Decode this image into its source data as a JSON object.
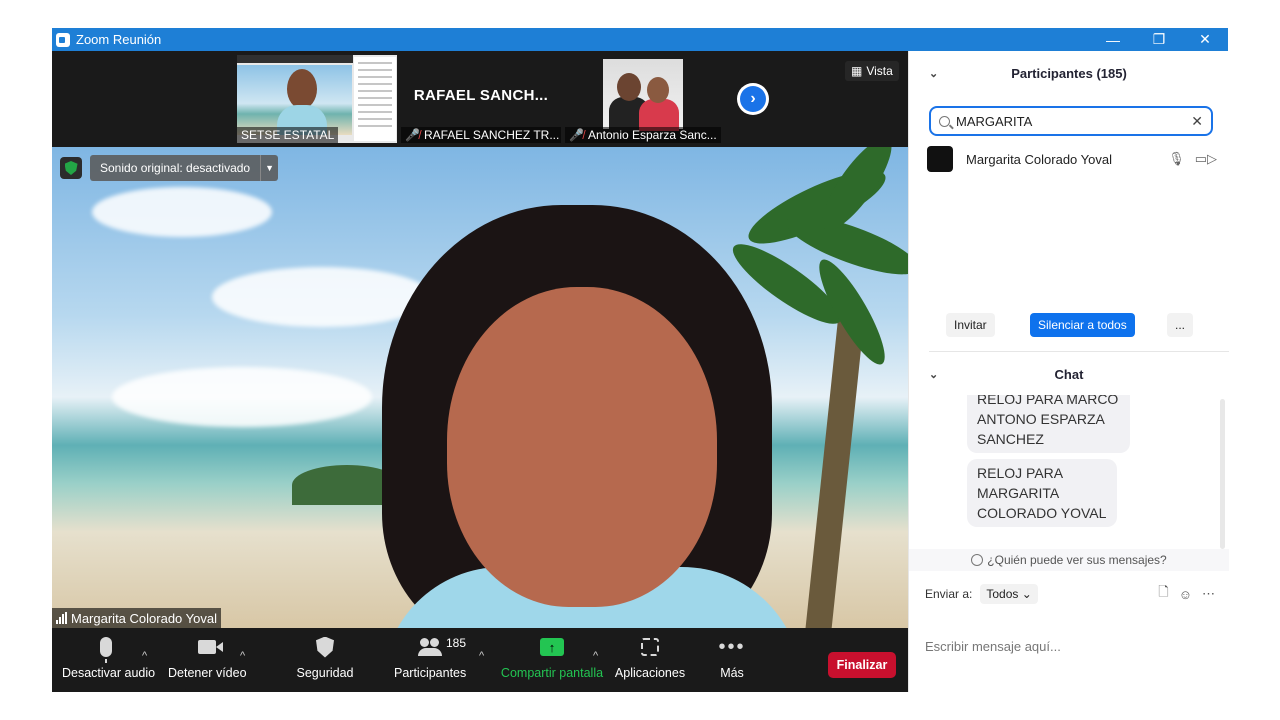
{
  "window": {
    "title": "Zoom Reunión",
    "minimize": "—",
    "restore": "❐",
    "close": "✕"
  },
  "thumbnails": [
    {
      "name": "SETSE ESTATAL",
      "muted": false
    },
    {
      "name": "RAFAEL SANCHEZ TR...",
      "big_name": "RAFAEL  SANCH...",
      "muted": true
    },
    {
      "name": "Antonio Esparza Sanc...",
      "muted": true
    }
  ],
  "view_button": "Vista",
  "audio_badge": {
    "label": "Sonido original: desactivado"
  },
  "speaker": {
    "name": "Margarita Colorado Yoval"
  },
  "toolbar": {
    "mute": "Desactivar audio",
    "video": "Detener vídeo",
    "security": "Seguridad",
    "participants": "Participantes",
    "participants_count": "185",
    "share": "Compartir pantalla",
    "apps": "Aplicaciones",
    "more": "Más",
    "end": "Finalizar"
  },
  "participants_panel": {
    "title": "Participantes (185)",
    "search_value": "MARGARITA",
    "results": [
      {
        "name": "Margarita Colorado Yoval"
      }
    ],
    "invite": "Invitar",
    "mute_all": "Silenciar a todos",
    "more": "..."
  },
  "chat": {
    "title": "Chat",
    "messages": [
      "RELOJ PARA MARCO ANTONO ESPARZA SANCHEZ",
      "RELOJ PARA MARGARITA COLORADO YOVAL"
    ],
    "who_can_see": "¿Quién puede ver sus mensajes?",
    "send_to_label": "Enviar a:",
    "send_to_value": "Todos",
    "input_placeholder": "Escribir mensaje aquí..."
  },
  "colors": {
    "titlebar": "#1e7fd6",
    "accent_blue": "#0e72ed",
    "end_red": "#c8102e",
    "share_green": "#23c552"
  }
}
